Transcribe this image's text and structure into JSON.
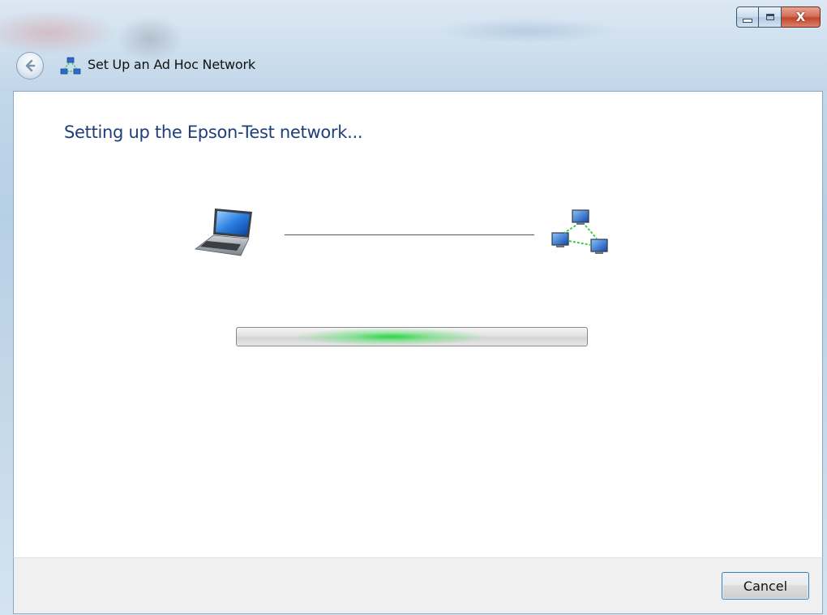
{
  "window": {
    "title": "Set Up an Ad Hoc Network",
    "caption_buttons": {
      "minimize_icon": "minimize-icon",
      "maximize_icon": "maximize-icon",
      "close_glyph": "X"
    }
  },
  "navigation": {
    "back_icon": "back-arrow-icon"
  },
  "main": {
    "heading": "Setting up the Epson-Test network...",
    "left_icon": "laptop-icon",
    "right_icon": "network-icon",
    "progress": {
      "mode": "indeterminate-marquee",
      "marquee_position_fraction": 0.44,
      "accent_color": "#1ed73c"
    }
  },
  "footer": {
    "cancel_label": "Cancel"
  },
  "colors": {
    "heading": "#1e3f7a",
    "content_background": "#ffffff",
    "footer_background": "#f0f0f0",
    "close_button": "#c2452b"
  }
}
